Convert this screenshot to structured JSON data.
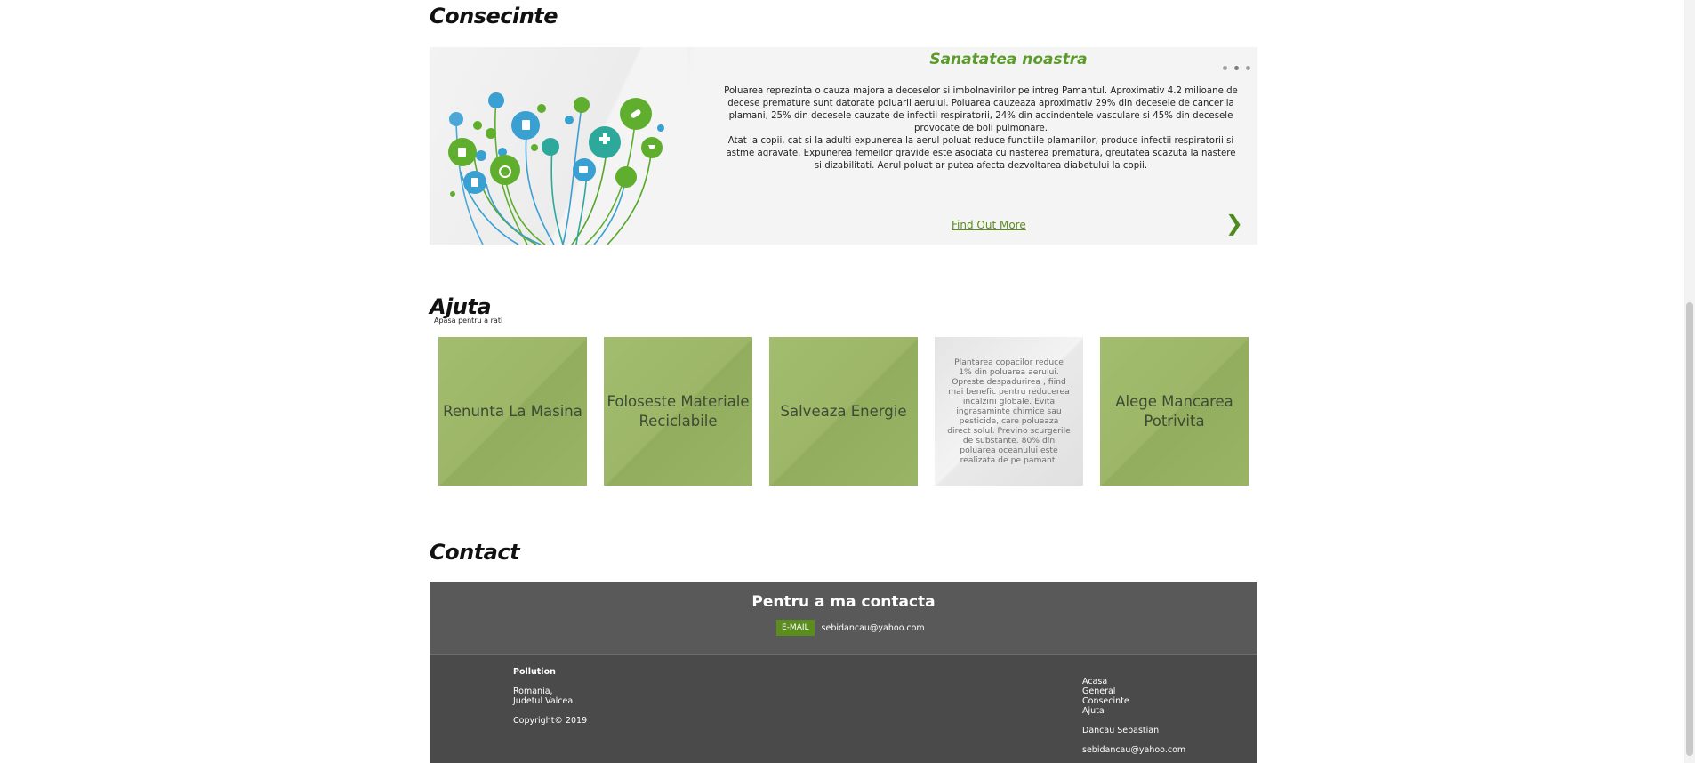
{
  "sections": {
    "consecinte": "Consecinte",
    "ajuta": "Ajuta",
    "contact": "Contact"
  },
  "slider": {
    "title": "Sanatatea noastra",
    "paragraph1": "Poluarea reprezinta o cauza majora a deceselor si imbolnavirilor pe intreg Pamantul. Aproximativ 4.2 milioane de decese premature sunt datorate poluarii aerului. Poluarea cauzeaza aproximativ 29% din decesele de cancer la plamani, 25% din decesele cauzate de infectii respiratorii, 24% din accindentele vasculare si 45% din decesele provocate de boli pulmonare.",
    "paragraph2": "Atat la copii, cat si la adulti expunerea la aerul poluat reduce functiile plamanilor, produce infectii respiratorii si astme agravate. Expunerea femeilor gravide este asociata cu nasterea prematura, greutatea scazuta la nastere si dizabilitati. Aerul poluat ar putea afecta dezvoltarea diabetului la copii.",
    "link": "Find Out More",
    "next_icon": "❯"
  },
  "ajuta": {
    "hint": "Apasa pentru a rati",
    "cards": [
      "Renunta La Masina",
      "Foloseste Materiale Reciclabile",
      "Salveaza Energie",
      "Plantarea copacilor reduce 1% din poluarea aerului. Opreste despadurirea , fiind mai benefic pentru reducerea incalzirii globale. Evita ingrasaminte chimice sau pesticide, care polueaza direct solul. Previno scurgerile de substante. 80% din poluarea oceanului este realizata de pe pamant.",
      "Alege Mancarea Potrivita"
    ]
  },
  "contact": {
    "heading": "Pentru a ma contacta",
    "email_label": "E-MAIL",
    "email": "sebidancau@yahoo.com"
  },
  "footer": {
    "left": {
      "brand": "Pollution",
      "address1": "Romania,",
      "address2": "Judetul Valcea",
      "copyright": "Copyright© 2019"
    },
    "right": {
      "links": [
        "Acasa",
        "General",
        "Consecinte",
        "Ajuta"
      ],
      "name": "Dancau Sebastian",
      "email": "sebidancau@yahoo.com"
    }
  },
  "colors": {
    "accent_green": "#5b8c1e",
    "card_green": "#9db667",
    "contact_bg": "#595959",
    "footer_bg": "#4a4a4a"
  }
}
